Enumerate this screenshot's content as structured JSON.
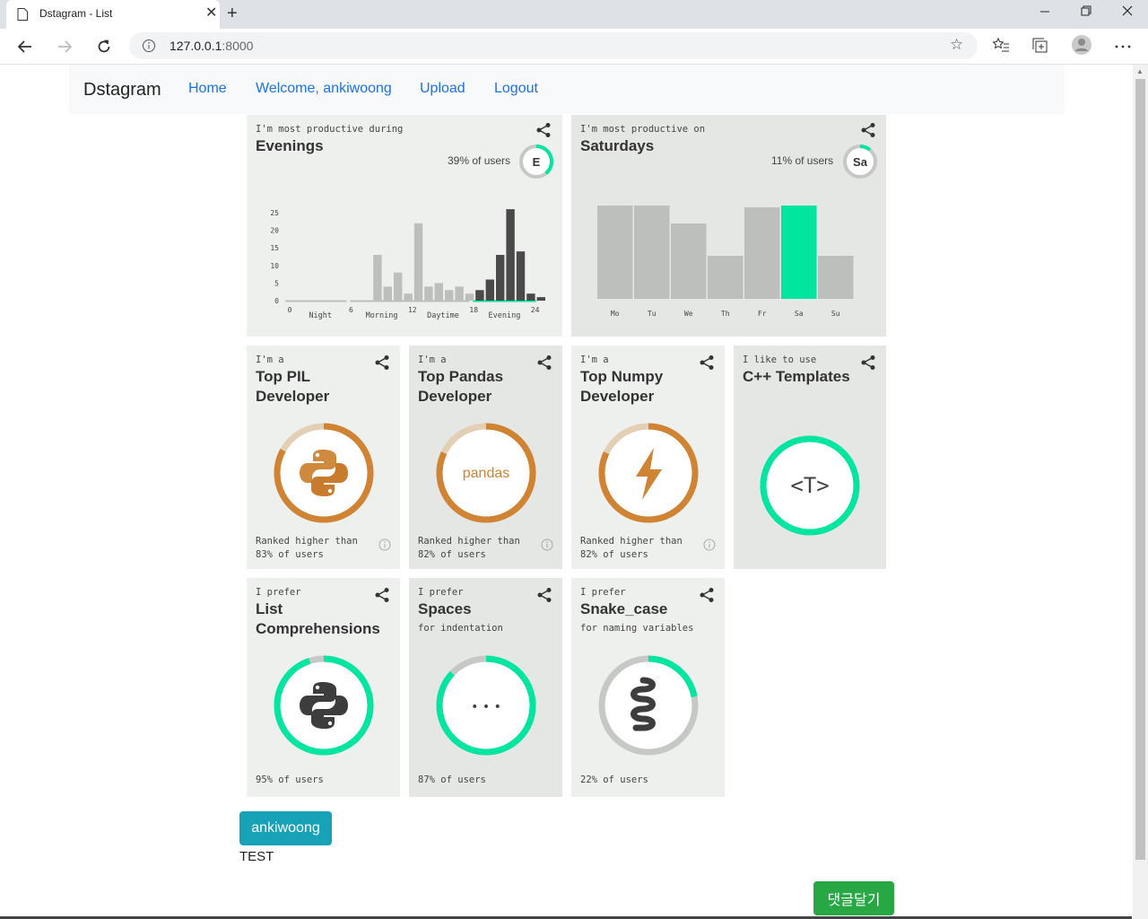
{
  "browser": {
    "tab_title": "Dstagram - List",
    "tab_close": "✕",
    "new_tab": "+",
    "url_host": "127.0.0.1",
    "url_port": ":8000",
    "window_controls": [
      "minimize",
      "restore",
      "close"
    ]
  },
  "navbar": {
    "brand": "Dstagram",
    "links": [
      "Home",
      "Welcome, ankiwoong",
      "Upload",
      "Logout"
    ]
  },
  "cards": {
    "time_of_day": {
      "small": "I'm most productive during",
      "title": "Evenings",
      "percent_text": "39% of users",
      "ring_letter": "E",
      "ring_fraction": 0.39
    },
    "weekday": {
      "small": "I'm most productive on",
      "title": "Saturdays",
      "percent_text": "11% of users",
      "ring_letter": "Sa",
      "ring_fraction": 0.11
    },
    "pil": {
      "small": "I'm a",
      "title_1": "Top PIL",
      "title_2": "Developer",
      "rank_1": "Ranked higher than",
      "rank_2": "83% of users",
      "fraction": 0.83
    },
    "pandas": {
      "small": "I'm a",
      "title_1": "Top Pandas",
      "title_2": "Developer",
      "icon_text": "pandas",
      "rank_1": "Ranked higher than",
      "rank_2": "82% of users",
      "fraction": 0.82
    },
    "numpy": {
      "small": "I'm a",
      "title_1": "Top Numpy",
      "title_2": "Developer",
      "rank_1": "Ranked higher than",
      "rank_2": "82% of users",
      "fraction": 0.82
    },
    "cpp": {
      "small": "I like to use",
      "title_1": "C++ Templates",
      "icon_text": "<T>",
      "fraction": 1.0
    },
    "listcomp": {
      "small": "I prefer",
      "title_1": "List",
      "title_2": "Comprehensions",
      "foot": "95% of users",
      "fraction": 0.95
    },
    "spaces": {
      "small": "I prefer",
      "title_1": "Spaces",
      "sub": "for indentation",
      "icon_text": "• • •",
      "foot": "87% of users",
      "fraction": 0.87
    },
    "snake": {
      "small": "I prefer",
      "title_1": "Snake_case",
      "sub": "for naming variables",
      "foot": "22% of users",
      "fraction": 0.22
    }
  },
  "chart_data": [
    {
      "type": "bar",
      "x": [
        0,
        1,
        2,
        3,
        4,
        5,
        6,
        7,
        8,
        9,
        10,
        11,
        12,
        13,
        14,
        15,
        16,
        17,
        18,
        19,
        20,
        21,
        22,
        23
      ],
      "values": [
        0,
        0,
        0,
        0,
        0,
        0,
        0,
        0,
        13,
        4,
        8,
        2,
        22,
        4,
        5,
        3,
        4,
        2,
        3,
        6,
        13,
        26,
        14,
        2,
        1
      ],
      "categories": [
        "0",
        "6",
        "12",
        "18",
        "24"
      ],
      "period_labels": [
        "Night",
        "Morning",
        "Daytime",
        "Evening"
      ],
      "y_ticks": [
        "25",
        "20",
        "15",
        "10",
        "5",
        "0"
      ],
      "ylim": [
        0,
        25
      ],
      "highlight_range": [
        18,
        24
      ],
      "colors": {
        "default": "#bdbfbc",
        "highlight": "#4a4a4a",
        "accent": "#00e5a0"
      }
    },
    {
      "type": "bar",
      "categories": [
        "Mo",
        "Tu",
        "We",
        "Th",
        "Fr",
        "Sa",
        "Su"
      ],
      "values": [
        104,
        104,
        84,
        48,
        102,
        104,
        48
      ],
      "highlight": "Sa",
      "colors": {
        "default": "#bdbfbc",
        "highlight": "#00e5a0"
      }
    }
  ],
  "author": {
    "name": "ankiwoong",
    "comment": "TEST"
  },
  "comment_button": "댓글달기",
  "colors": {
    "accent": "#00e5a0",
    "orange": "#cf8333",
    "orange_light": "#e2cfb4",
    "link": "#1a73e8"
  }
}
